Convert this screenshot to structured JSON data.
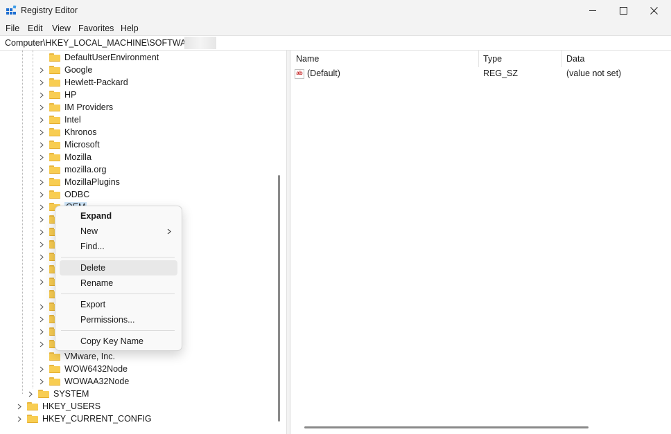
{
  "window": {
    "title": "Registry Editor",
    "controls": {
      "minimize": "minimize-icon",
      "maximize": "maximize-icon",
      "close": "close-icon"
    }
  },
  "menu": [
    "File",
    "Edit",
    "View",
    "Favorites",
    "Help"
  ],
  "address": {
    "path": "Computer\\HKEY_LOCAL_MACHINE\\SOFTWARE\\"
  },
  "tree": {
    "software_children": [
      "DefaultUserEnvironment",
      "Google",
      "Hewlett-Packard",
      "HP",
      "IM Providers",
      "Intel",
      "Khronos",
      "Microsoft",
      "Mozilla",
      "mozilla.org",
      "MozillaPlugins",
      "ODBC",
      "OEM",
      "VMware, Inc.",
      "WOW6432Node",
      "WOWAA32Node"
    ],
    "system": "SYSTEM",
    "roots": [
      "HKEY_USERS",
      "HKEY_CURRENT_CONFIG"
    ]
  },
  "list": {
    "columns": {
      "name": "Name",
      "type": "Type",
      "data": "Data"
    },
    "rows": [
      {
        "name": "(Default)",
        "type": "REG_SZ",
        "data": "(value not set)",
        "icon": "string-value-icon"
      }
    ]
  },
  "context_menu": {
    "items": [
      "Expand",
      "New",
      "Find...",
      "Delete",
      "Rename",
      "Export",
      "Permissions...",
      "Copy Key Name"
    ],
    "highlighted": "Delete"
  },
  "colors": {
    "folder": "#f8cd52",
    "window_bg": "#f3f3f3",
    "accent": "#0067c0"
  }
}
